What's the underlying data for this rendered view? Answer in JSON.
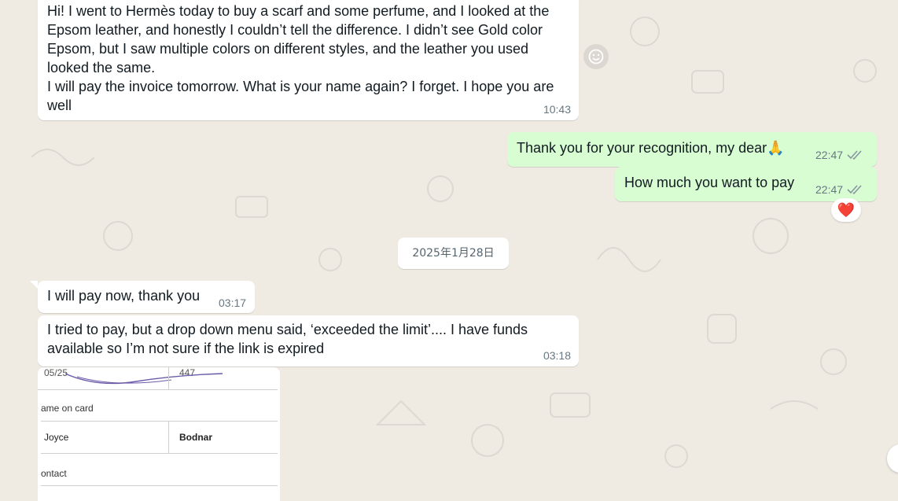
{
  "messages": {
    "m1": {
      "text": "Hi! I went to Hermès today to buy a scarf and some perfume, and I looked at the Epsom leather, and honestly I couldn’t tell the difference. I didn’t see Gold color Epsom, but I saw multiple colors on different styles, and the leather you used looked the same.\nI will pay the invoice tomorrow. What is your name again? I forget. I hope you are well",
      "time": "10:43"
    },
    "m2": {
      "text": "Thank you for your recognition, my dear🙏",
      "time": "22:47"
    },
    "m3": {
      "text": "How much you want to pay",
      "time": "22:47",
      "reaction": "❤️"
    },
    "date_divider": "2025年1月28日",
    "m4": {
      "text": "I will pay now, thank you",
      "time": "03:17"
    },
    "m5": {
      "text": "I tried to pay, but a drop down menu said, ‘exceeded the limit’.... I have funds available so I’m not sure if the link is expired",
      "time": "03:18"
    },
    "image_form": {
      "top_left": "05/25",
      "top_right": "447",
      "name_label": "ame on card",
      "first_name": "Joyce",
      "last_name": "Bodnar",
      "contact_label": "ontact"
    }
  },
  "icons": {
    "emoji": "smiley-icon",
    "read_receipt": "double-check-icon"
  },
  "colors": {
    "background": "#efeae2",
    "incoming": "#ffffff",
    "outgoing": "#d9fdd3",
    "timestamp": "#667781",
    "read_ticks": "#8696a0"
  }
}
